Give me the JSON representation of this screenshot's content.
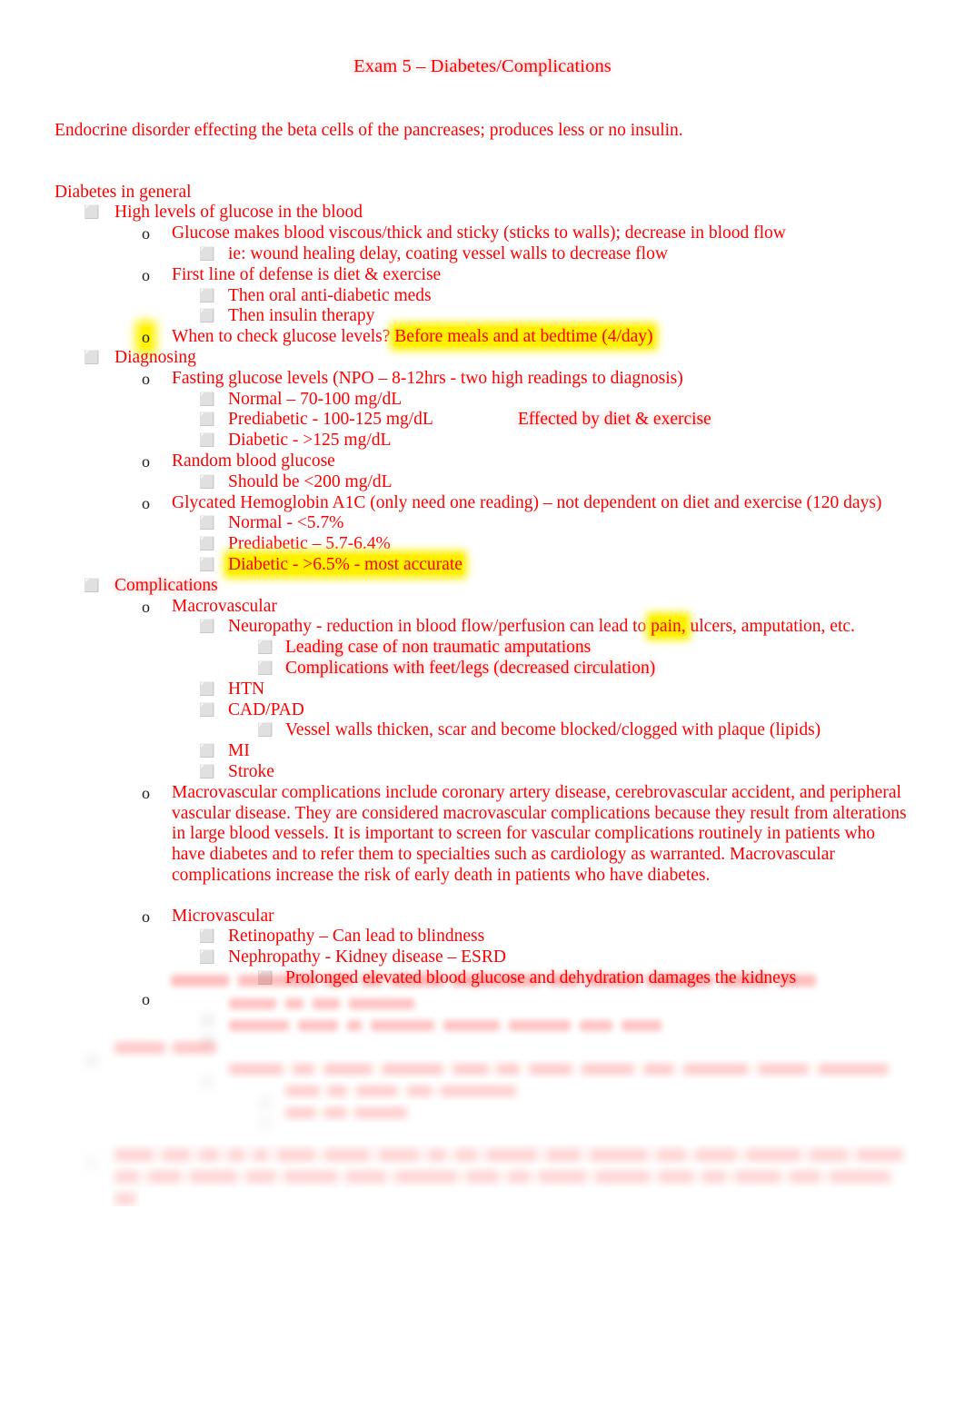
{
  "document": {
    "title": "Exam 5 – Diabetes/Complications",
    "intro": "Endocrine disorder effecting the beta cells of the pancreases; produces less or no insulin.",
    "section_heading": "Diabetes in general",
    "text_color": "#FF0000",
    "highlight_color": "#FFF000",
    "bullet_glyph": "⬜",
    "bullet_o": "o"
  },
  "outline": {
    "high_glucose": {
      "label": "High levels of glucose in the blood",
      "viscous": "Glucose makes blood viscous/thick and sticky (sticks to walls); decrease in blood flow",
      "viscous_sub": "ie: wound healing delay, coating vessel walls to decrease flow",
      "first_line": "First line of defense is diet & exercise",
      "first_line_sub1": "Then oral anti-diabetic meds",
      "first_line_sub2": "Then insulin therapy",
      "when_check_q": "When to check glucose levels? ",
      "when_check_a": "Before meals and at bedtime (4/day)"
    },
    "diagnosing": {
      "label": "Diagnosing",
      "fasting": "Fasting glucose levels (NPO – 8-12hrs - two high readings to diagnosis)",
      "fasting_normal": "Normal – 70-100 mg/dL",
      "fasting_prediabetic": "Prediabetic - 100-125 mg/dL",
      "fasting_prediabetic_note": "Effected by diet & exercise",
      "fasting_diabetic": "Diabetic - >125 mg/dL",
      "random": "Random blood glucose",
      "random_sub": "Should be <200 mg/dL",
      "a1c": "Glycated Hemoglobin A1C (only need one reading) – not dependent on diet and exercise (120 days)",
      "a1c_normal": "Normal - <5.7%",
      "a1c_prediabetic": "Prediabetic – 5.7-6.4%",
      "a1c_diabetic": "Diabetic - >6.5% - most accurate"
    },
    "complications": {
      "label": "Complications",
      "macrovascular": "Macrovascular",
      "neuropathy_pre": "Neuropathy   - reduction in blood flow/perfusion can lead to ",
      "neuropathy_hl": "pain,",
      "neuropathy_post": " ulcers, amputation, etc.",
      "neuropathy_sub1": "Leading case of non traumatic amputations",
      "neuropathy_sub2": "Complications with feet/legs (decreased circulation)",
      "htn": "HTN",
      "cad_pad": "CAD/PAD",
      "cad_pad_sub": "Vessel walls thicken, scar and become blocked/clogged with plaque (lipids)",
      "mi": "MI",
      "stroke": "Stroke",
      "macro_paragraph": "Macrovascular complications    include coronary artery disease, cerebrovascular accident, and peripheral vascular disease. They are considered macrovascular complications because they result from alterations in large blood vessels. It is important to screen for vascular complications routinely in patients who have diabetes and to refer them to specialties such as cardiology as warranted. Macrovascular complications increase the risk of early death in patients who have diabetes.",
      "microvascular": "Microvascular",
      "retinopathy": "Retinopathy – Can lead to blindness",
      "nephropathy": "Nephropathy - Kidney disease – ESRD",
      "nephropathy_sub": "Prolonged elevated blood glucose and dehydration damages the kidneys"
    },
    "faded": {
      "note": "Remaining lines are blurred and faded out of legibility in the source page.",
      "line_1": "",
      "line_2": "",
      "line_3": "",
      "line_4": "",
      "line_5": "",
      "line_6": "",
      "line_7": "",
      "line_8": "",
      "line_9": "",
      "line_10": "",
      "line_11": "",
      "line_12": ""
    }
  }
}
